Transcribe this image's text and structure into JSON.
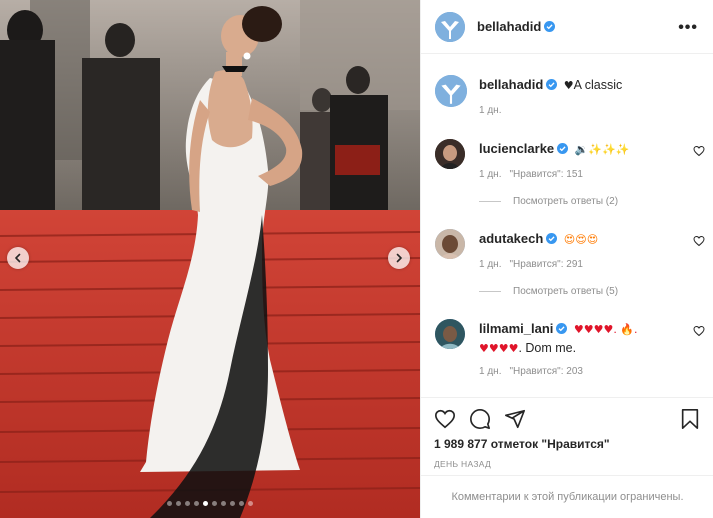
{
  "post": {
    "author": "bellahadid",
    "caption_text": "A classic",
    "caption_emoji": "♥",
    "caption_time": "1 дн."
  },
  "header": {
    "username": "bellahadid",
    "more_label": "•••"
  },
  "comments": [
    {
      "username": "lucienclarke",
      "emoji": "🔉✨✨✨",
      "text": "",
      "time": "1 дн.",
      "likes_label": "\"Нравится\": 151",
      "replies_label": "Посмотреть ответы (2)"
    },
    {
      "username": "adutakech",
      "emoji": "😍😍😍",
      "text": "",
      "time": "1 дн.",
      "likes_label": "\"Нравится\": 291",
      "replies_label": "Посмотреть ответы (5)"
    },
    {
      "username": "lilmami_lani",
      "emoji": "♥♥♥♥. 🔥.",
      "emoji_line2": "♥♥♥♥",
      "text": ". Dom me.",
      "time": "1 дн.",
      "likes_label": "\"Нравится\": 203",
      "replies_label": ""
    }
  ],
  "stats": {
    "likes_label": "1 989 877 отметок \"Нравится\"",
    "posted_ago": "ДЕНЬ НАЗАД"
  },
  "footer": {
    "comments_disabled": "Комментарии к этой публикации ограничены."
  },
  "carousel": {
    "dot_count": 10,
    "active_index": 4
  },
  "colors": {
    "verified": "#3897f0",
    "muted": "#8e8e8e",
    "carpet": "#c7362b"
  },
  "icons": [
    "verified-icon",
    "more-icon",
    "heart-icon",
    "comment-icon",
    "share-icon",
    "bookmark-icon",
    "chevron-left-icon",
    "chevron-right-icon"
  ]
}
